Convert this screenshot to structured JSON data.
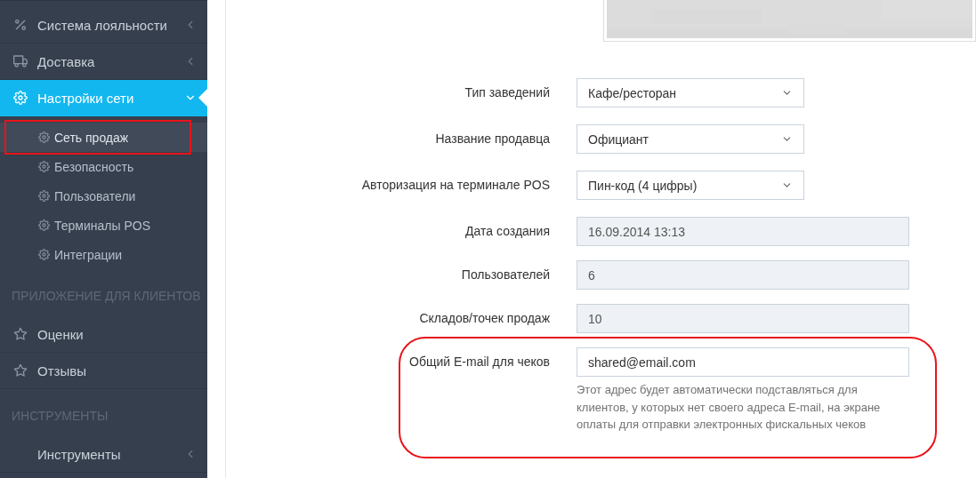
{
  "sidebar": {
    "items": [
      {
        "kind": "item",
        "label": "Система лояльности",
        "expanded": false,
        "selected": false
      },
      {
        "kind": "item",
        "label": "Доставка",
        "expanded": false,
        "selected": false
      },
      {
        "kind": "item",
        "label": "Настройки сети",
        "expanded": true,
        "selected": true,
        "children": [
          {
            "label": "Сеть продаж",
            "selected": true,
            "highlighted": true
          },
          {
            "label": "Безопасность",
            "selected": false,
            "highlighted": false
          },
          {
            "label": "Пользователи",
            "selected": false,
            "highlighted": false
          },
          {
            "label": "Терминалы POS",
            "selected": false,
            "highlighted": false
          },
          {
            "label": "Интеграции",
            "selected": false,
            "highlighted": false
          }
        ]
      },
      {
        "kind": "header",
        "label": "ПРИЛОЖЕНИЕ ДЛЯ КЛИЕНТОВ"
      },
      {
        "kind": "item",
        "label": "Оценки",
        "selected": false
      },
      {
        "kind": "item",
        "label": "Отзывы",
        "selected": false
      },
      {
        "kind": "header",
        "label": "ИНСТРУМЕНТЫ"
      },
      {
        "kind": "item",
        "label": "Инструменты",
        "expanded": false,
        "selected": false
      }
    ]
  },
  "form": {
    "fields": [
      {
        "kind": "select",
        "label": "Тип заведений",
        "value": "Кафе/ресторан",
        "highlighted": false
      },
      {
        "kind": "select",
        "label": "Название продавца",
        "value": "Официант",
        "highlighted": false
      },
      {
        "kind": "select",
        "label": "Авторизация на терминале POS",
        "value": "Пин-код (4 цифры)",
        "highlighted": false
      },
      {
        "kind": "readonly",
        "label": "Дата создания",
        "value": "16.09.2014 13:13",
        "highlighted": false
      },
      {
        "kind": "readonly",
        "label": "Пользователей",
        "value": "6",
        "highlighted": false
      },
      {
        "kind": "readonly",
        "label": "Складов/точек продаж",
        "value": "10",
        "highlighted": false
      },
      {
        "kind": "input",
        "label": "Общий E-mail для чеков",
        "value": "shared@email.com",
        "help": "Этот адрес будет автоматически подставляться для клиентов, у которых нет своего адреса E-mail, на экране оплаты для отправки электронных фискальных чеков",
        "highlighted": true
      }
    ]
  }
}
